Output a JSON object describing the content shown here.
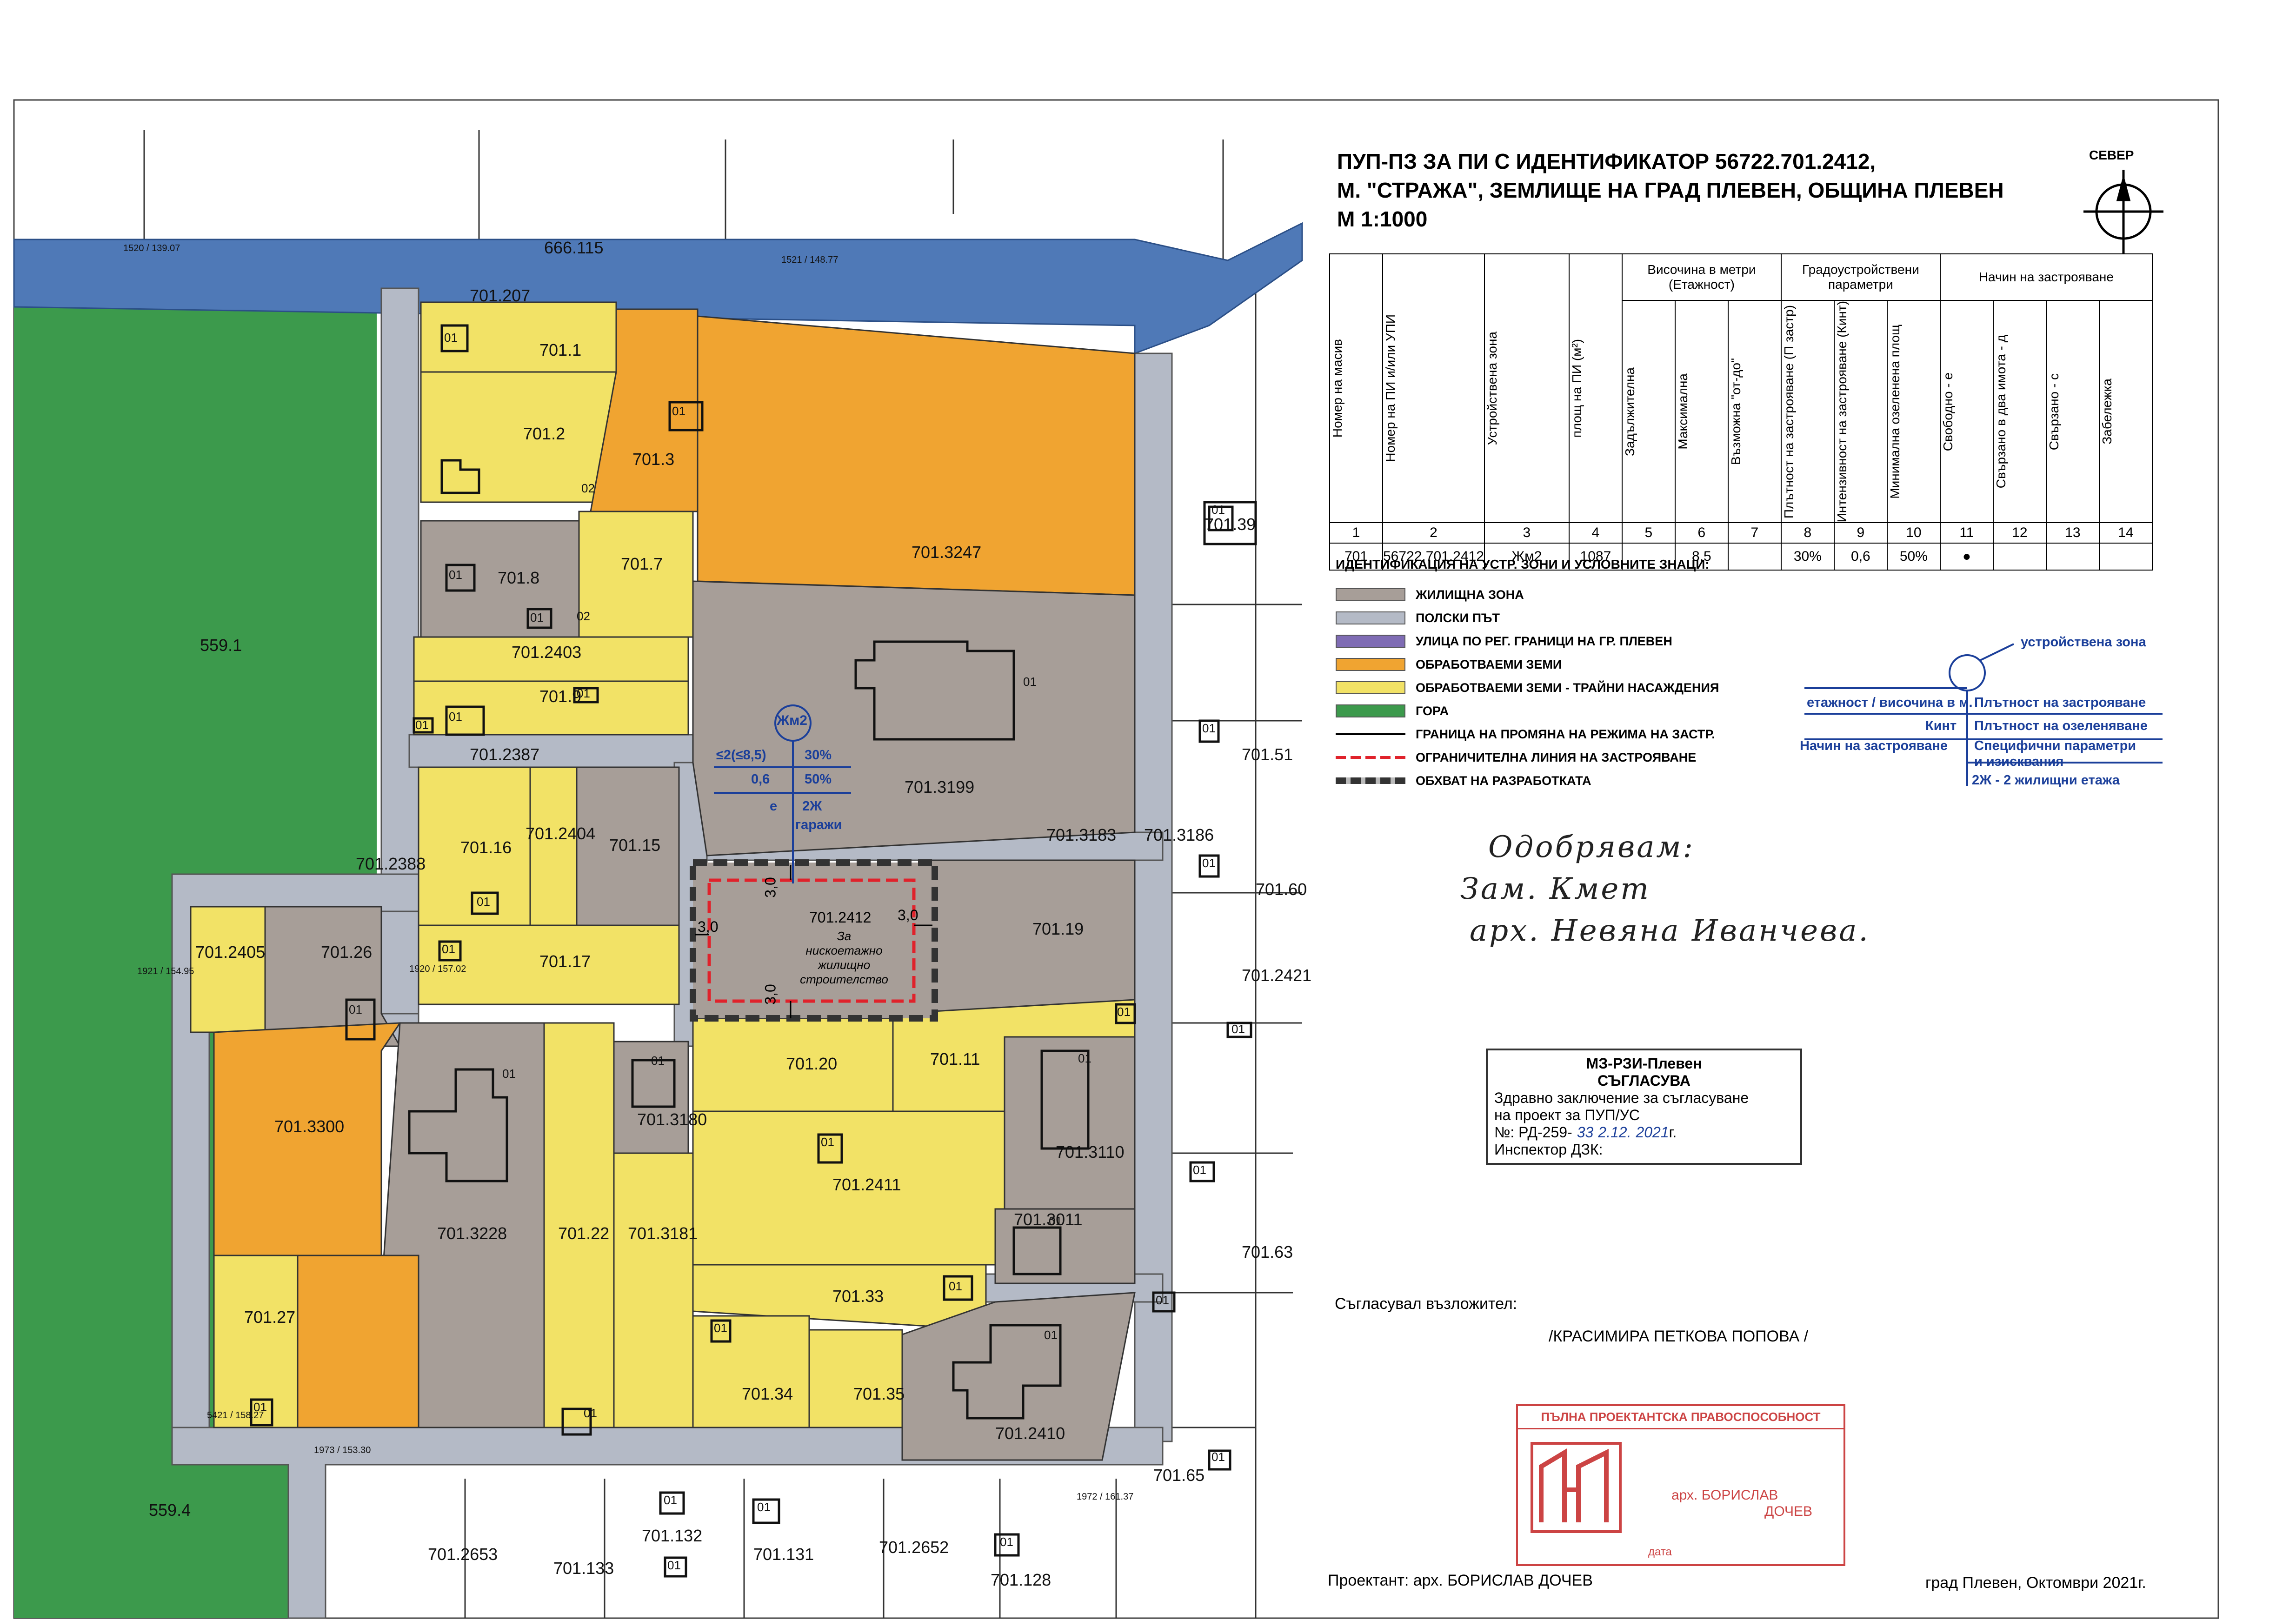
{
  "title": {
    "line1": "ПУП-ПЗ ЗА ПИ С ИДЕНТИФИКАТОР 56722.701.2412,",
    "line2": "М. \"СТРАЖА\", ЗЕМЛИЩЕ НА ГРАД ПЛЕВЕН, ОБЩИНА ПЛЕВЕН",
    "line3": "М 1:1000"
  },
  "north_label": "СЕВЕР",
  "colors": {
    "residential": "#a79e98",
    "road": "#b4bac6",
    "river": "#4f79b7",
    "arable": "#f0a431",
    "orchard": "#f2e266",
    "forest": "#3c9a4c",
    "street_border": "#7f6cb4",
    "zone_key": "#1b3f9a",
    "restriction": "#e0222b"
  },
  "table": {
    "header": {
      "c1": "Номер на масив",
      "c2": "Номер на ПИ и/или УПИ",
      "c3": "Устройствена зона",
      "c4": "площ на ПИ (м²)",
      "height_group": "Височина в метри (Етажност)",
      "c5": "Задължителна",
      "c6": "Максимална",
      "c7": "Възможна \"от-до\"",
      "urban_group": "Градоустройствени параметри",
      "c8": "Плътност на застрояване (П застр)",
      "c9": "Интензивност на застрояване (Кинт)",
      "c10": "Минимална озеленена площ",
      "build_group": "Начин на застрояване",
      "c11": "Свободно - е",
      "c12": "Свързано в два имота - д",
      "c13": "Свързано - с",
      "c14": "Забележка"
    },
    "numbers": [
      "1",
      "2",
      "3",
      "4",
      "5",
      "6",
      "7",
      "8",
      "9",
      "10",
      "11",
      "12",
      "13",
      "14"
    ],
    "row": [
      "701",
      "56722.701.2412",
      "Жм2",
      "1087",
      "",
      "8.5",
      "",
      "30%",
      "0,6",
      "50%",
      "●",
      "",
      "",
      ""
    ]
  },
  "legend": {
    "title": "ИДЕНТИФИКАЦИЯ НА УСТР. ЗОНИ И УСЛОВНИТЕ ЗНАЦИ:",
    "items": [
      "ЖИЛИЩНА ЗОНА",
      "ПОЛСКИ ПЪТ",
      "УЛИЦА ПО РЕГ. ГРАНИЦИ НА ГР. ПЛЕВЕН",
      "ОБРАБОТВАЕМИ ЗЕМИ",
      "ОБРАБОТВАЕМИ ЗЕМИ - ТРАЙНИ НАСАЖДЕНИЯ",
      "ГОРА",
      "ГРАНИЦА НА ПРОМЯНА НА РЕЖИМА НА ЗАСТР.",
      "ОГРАНИЧИТЕЛНА ЛИНИЯ НА ЗАСТРОЯВАНЕ",
      "ОБХВАТ НА РАЗРАБОТКАТА"
    ]
  },
  "zone_key": {
    "zone": "устройствена зона",
    "floors": "етажност / височина в м.",
    "kint": "Кинт",
    "method": "Начин на застрояване",
    "density": "Плътност на застрояване",
    "green": "Плътност на озеленяване",
    "specific": "Специфични параметри",
    "specific2": "и изисквания",
    "note": "2Ж - 2 жилищни етажа"
  },
  "zone_tag": {
    "code": "Жм2",
    "height": "≤2(≤8,5)",
    "density": "30%",
    "kint": "0,6",
    "green": "50%",
    "method": "е",
    "floors": "2Ж",
    "garages": "гаражи"
  },
  "subject": {
    "id": "701.2412",
    "purpose1": "За нискоетажно",
    "purpose2": "жилищно",
    "purpose3": "строителство",
    "offset": "3,0"
  },
  "handwritten": {
    "l1": "Одобрявам:",
    "l2": "Зам. Кмет",
    "l3": "арх. Невяна Иванчева."
  },
  "stamp_rzi": {
    "l1": "МЗ-РЗИ-Плевен",
    "l2": "СЪГЛАСУВА",
    "l3": "Здравно заключение за съгласуване",
    "l4": "на проект за ПУП/УС",
    "l5": "№: РД-259-",
    "l5b": "33",
    "l5c": "2.12.",
    "l5d": "2021",
    "l5e": "г.",
    "l6": "Инспектор ДЗК:"
  },
  "agreed": {
    "label": "Съгласувал възложител:",
    "name": "/КРАСИМИРА ПЕТКОВА ПОПОВА /"
  },
  "license_stamp": {
    "title": "ПЪЛНА ПРОЕКТАНТСКА ПРАВОСПОСОБНОСТ",
    "arch": "арх. БОРИСЛАВ",
    "surname": "ДОЧЕВ",
    "date": "дата"
  },
  "footer": {
    "designer": "Проектант: арх. БОРИСЛАВ ДОЧЕВ",
    "place": "град Плевен, Октомври 2021г."
  },
  "parcels": [
    {
      "id": "666.115",
      "kind": "river"
    },
    {
      "id": "701.207",
      "kind": "label"
    },
    {
      "id": "701.1",
      "kind": "orchard"
    },
    {
      "id": "701.2",
      "kind": "orchard"
    },
    {
      "id": "701.3",
      "kind": "arable"
    },
    {
      "id": "701.3247",
      "kind": "arable"
    },
    {
      "id": "701.8",
      "kind": "residential"
    },
    {
      "id": "701.7",
      "kind": "orchard"
    },
    {
      "id": "701.2403",
      "kind": "orchard"
    },
    {
      "id": "701.9",
      "kind": "orchard"
    },
    {
      "id": "701.2387",
      "kind": "road"
    },
    {
      "id": "701.3199",
      "kind": "residential"
    },
    {
      "id": "701.16",
      "kind": "orchard"
    },
    {
      "id": "701.2404",
      "kind": "orchard"
    },
    {
      "id": "701.15",
      "kind": "residential"
    },
    {
      "id": "701.2388",
      "kind": "road"
    },
    {
      "id": "701.3183",
      "kind": "road"
    },
    {
      "id": "701.3186",
      "kind": "road"
    },
    {
      "id": "701.19",
      "kind": "residential"
    },
    {
      "id": "701.17",
      "kind": "orchard"
    },
    {
      "id": "701.2405",
      "kind": "orchard"
    },
    {
      "id": "701.26",
      "kind": "residential"
    },
    {
      "id": "701.20",
      "kind": "orchard"
    },
    {
      "id": "701.11",
      "kind": "orchard"
    },
    {
      "id": "701.3180",
      "kind": "residential"
    },
    {
      "id": "701.3110",
      "kind": "residential"
    },
    {
      "id": "701.3300",
      "kind": "arable"
    },
    {
      "id": "701.2411",
      "kind": "orchard"
    },
    {
      "id": "701.3228",
      "kind": "residential"
    },
    {
      "id": "701.22",
      "kind": "orchard"
    },
    {
      "id": "701.3181",
      "kind": "orchard"
    },
    {
      "id": "701.3011",
      "kind": "residential"
    },
    {
      "id": "701.33",
      "kind": "orchard"
    },
    {
      "id": "701.27",
      "kind": "orchard"
    },
    {
      "id": "701.34",
      "kind": "orchard"
    },
    {
      "id": "701.35",
      "kind": "orchard"
    },
    {
      "id": "701.2410",
      "kind": "residential"
    },
    {
      "id": "559.1",
      "kind": "forest"
    },
    {
      "id": "559.4",
      "kind": "forest"
    },
    {
      "id": "701.39",
      "kind": "white"
    },
    {
      "id": "701.51",
      "kind": "white"
    },
    {
      "id": "701.60",
      "kind": "white"
    },
    {
      "id": "701.2421",
      "kind": "white"
    },
    {
      "id": "701.63",
      "kind": "white"
    },
    {
      "id": "701.65",
      "kind": "white"
    },
    {
      "id": "701.2653",
      "kind": "white"
    },
    {
      "id": "701.132",
      "kind": "white"
    },
    {
      "id": "701.133",
      "kind": "white"
    },
    {
      "id": "701.131",
      "kind": "white"
    },
    {
      "id": "701.2652",
      "kind": "white"
    },
    {
      "id": "701.128",
      "kind": "white"
    }
  ],
  "building_no": "01",
  "building_no_2": "02",
  "building_no_3": "03",
  "survey_points": [
    {
      "id": "1520",
      "value": "139.07"
    },
    {
      "id": "1521",
      "value": "148.77"
    },
    {
      "id": "1920",
      "value": "157.02"
    },
    {
      "id": "1921",
      "value": "154.95"
    },
    {
      "id": "5421",
      "value": "158.27"
    },
    {
      "id": "1973",
      "value": "153.30"
    },
    {
      "id": "1972",
      "value": "161.37"
    }
  ]
}
